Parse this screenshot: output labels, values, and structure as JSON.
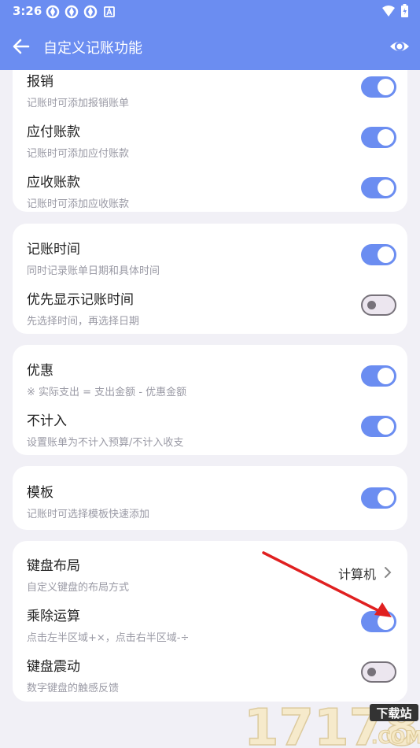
{
  "status_bar": {
    "time": "3:26"
  },
  "header": {
    "title": "自定义记账功能"
  },
  "colors": {
    "accent": "#6b8df1",
    "background": "#f1f0f6"
  },
  "cards": [
    {
      "rows": [
        {
          "title": "报销",
          "subtitle": "记账时可添加报销账单",
          "toggle": "on"
        },
        {
          "title": "应付账款",
          "subtitle": "记账时可添加应付账款",
          "toggle": "on"
        },
        {
          "title": "应收账款",
          "subtitle": "记账时可添加应收账款",
          "toggle": "on"
        }
      ]
    },
    {
      "rows": [
        {
          "title": "记账时间",
          "subtitle": "同时记录账单日期和具体时间",
          "toggle": "on"
        },
        {
          "title": "优先显示记账时间",
          "subtitle": "先选择时间，再选择日期",
          "toggle": "off"
        }
      ]
    },
    {
      "rows": [
        {
          "title": "优惠",
          "subtitle": "※ 实际支出 = 支出金额 - 优惠金额",
          "toggle": "on"
        },
        {
          "title": "不计入",
          "subtitle": "设置账单为不计入预算/不计入收支",
          "toggle": "on"
        }
      ]
    },
    {
      "rows": [
        {
          "title": "模板",
          "subtitle": "记账时可选择模板快速添加",
          "toggle": "on"
        }
      ]
    },
    {
      "rows": [
        {
          "title": "键盘布局",
          "subtitle": "自定义键盘的布局方式",
          "value": "计算机"
        },
        {
          "title": "乘除运算",
          "subtitle": "点击左半区域+×，点击右半区域-÷",
          "toggle": "on"
        },
        {
          "title": "键盘震动",
          "subtitle": "数字键盘的触感反馈",
          "toggle": "off"
        }
      ]
    }
  ],
  "watermark": {
    "number": "17178",
    "tag": "下载站",
    "domain": ".COM"
  }
}
